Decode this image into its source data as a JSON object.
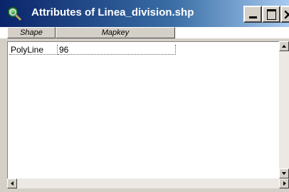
{
  "window": {
    "title": "Attributes of Linea_division.shp",
    "icon": "globe-magnifier-icon"
  },
  "table": {
    "columns": [
      "Shape",
      "Mapkey"
    ],
    "rows": [
      [
        "PolyLine",
        "96"
      ]
    ]
  },
  "colors": {
    "titlebar_start": "#0a246a",
    "titlebar_end": "#a6caf0",
    "face": "#d4d0c8"
  }
}
